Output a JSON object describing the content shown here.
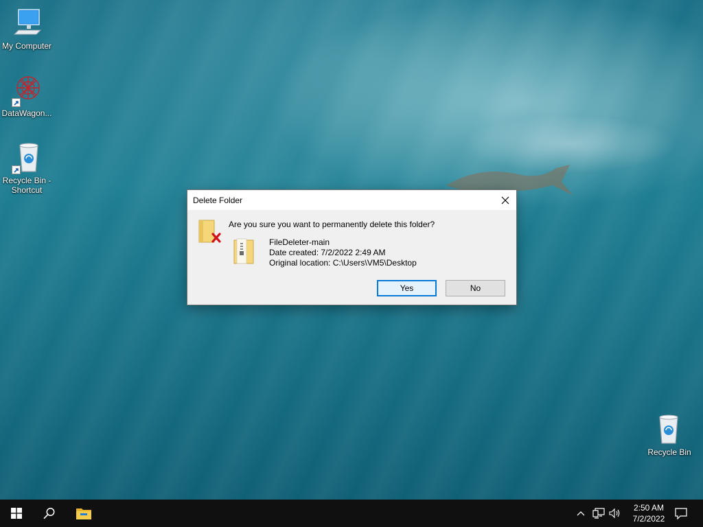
{
  "desktop": {
    "icons": [
      {
        "label": "My Computer"
      },
      {
        "label": "DataWagon..."
      },
      {
        "label": "Recycle Bin - Shortcut"
      },
      {
        "label": "Recycle Bin"
      }
    ]
  },
  "dialog": {
    "title": "Delete Folder",
    "question": "Are you sure you want to permanently delete this folder?",
    "file_name": "FileDeleter-main",
    "date_created": "Date created: 7/2/2022 2:49 AM",
    "original_location": "Original location: C:\\Users\\VM5\\Desktop",
    "yes_label": "Yes",
    "no_label": "No"
  },
  "taskbar": {
    "time": "2:50 AM",
    "date": "7/2/2022"
  },
  "colors": {
    "accent": "#0078d7",
    "taskbar": "#101010",
    "dialog_bg": "#f0f0f0"
  },
  "icons": [
    "monitor-icon",
    "datawagon-icon",
    "recycle-bin-icon",
    "shortcut-arrow-icon",
    "close-icon",
    "folder-delete-icon",
    "zip-folder-icon",
    "windows-start-icon",
    "search-icon",
    "file-explorer-icon",
    "chevron-up-icon",
    "network-icon",
    "volume-icon",
    "notification-icon"
  ]
}
